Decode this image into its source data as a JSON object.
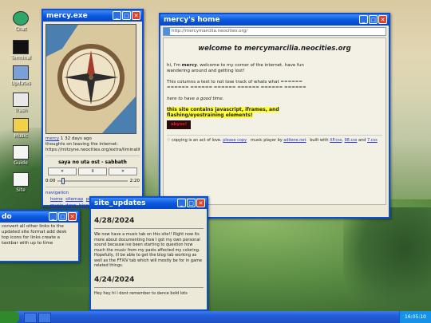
{
  "desktop_icons": [
    {
      "label": "Chat",
      "color": "#2fa66a"
    },
    {
      "label": "Terminal",
      "color": "#111111"
    },
    {
      "label": "Updates",
      "color": "#7aa0d8"
    },
    {
      "label": "Trash",
      "color": "#e8e8e8"
    },
    {
      "label": "Music",
      "color": "#f2d04a"
    },
    {
      "label": "Guide",
      "color": "#f4f4f4"
    },
    {
      "label": "Site",
      "color": "#f5f5f5"
    }
  ],
  "mercy_exe": {
    "title": "mercy.exe",
    "status_user": "mercy",
    "status_ago": " 1 32 days ago",
    "status_text": "thoughts on leaving the internet:",
    "status_link": "https://mitzyne.neocities.org/extra/liminality",
    "track": "saya no uta ost - sabbath",
    "btn_prev": "«",
    "btn_pause": "॥",
    "btn_next": "»",
    "time_current": "0:00",
    "time_total": "2:20",
    "nav_label": "navigation",
    "nav": [
      "home",
      "sitemap",
      "personal_music",
      "music_drew",
      "blog"
    ],
    "progress": 0.05
  },
  "home_window": {
    "title": "mercy's home",
    "address": "http://mercymarcilia.neocities.org/",
    "welcome": "welcome to mercymarcilia.neocities.org",
    "intro_pre": "hi, I'm ",
    "intro_name": "mercy",
    "intro_post": ". welcome to my corner of the internet. have fun",
    "intro_line2": "wandering around and getting lost!",
    "columns_line1": "This columns a test to not lose track of whats what ======",
    "columns_line2": "====== ====== ====== ====== ====== ======",
    "good_time": "here to have a good time.",
    "warning_line1": "this site contains javascript, iframes, and",
    "warning_line2": "flashing/eyestraining elements!",
    "badge": "abyss!",
    "footer_copy": "♡ copying is an act of love. ",
    "footer_please": "please copy",
    "footer_music": "music player by ",
    "footer_music_link": "adilene.net",
    "footer_built": "built with ",
    "footer_xp": "XP.css",
    "footer_98": "98.css",
    "footer_and": "and",
    "footer_7": "7.css"
  },
  "site_updates": {
    "title": "site_updates",
    "entries": [
      {
        "date": "4/28/2024",
        "text": "We now have a music tab on this site!! Right now its more about documenting how I got my own personal sound because ive been starting to question how much the music from my pasts affected my coloring. Hopefully, ill be able to get the blog tab working as well as the FFXIV tab which will mostly be for in game related things."
      },
      {
        "date": "4/24/2024",
        "text": "Hey hey hi i dont remember to dance bold lots"
      }
    ]
  },
  "todo_window": {
    "title": "do",
    "text": "convert all other links to the updated site format add desk top icons for links create a taskbar with up to time"
  },
  "taskbar": {
    "clock": "16:05:10"
  }
}
